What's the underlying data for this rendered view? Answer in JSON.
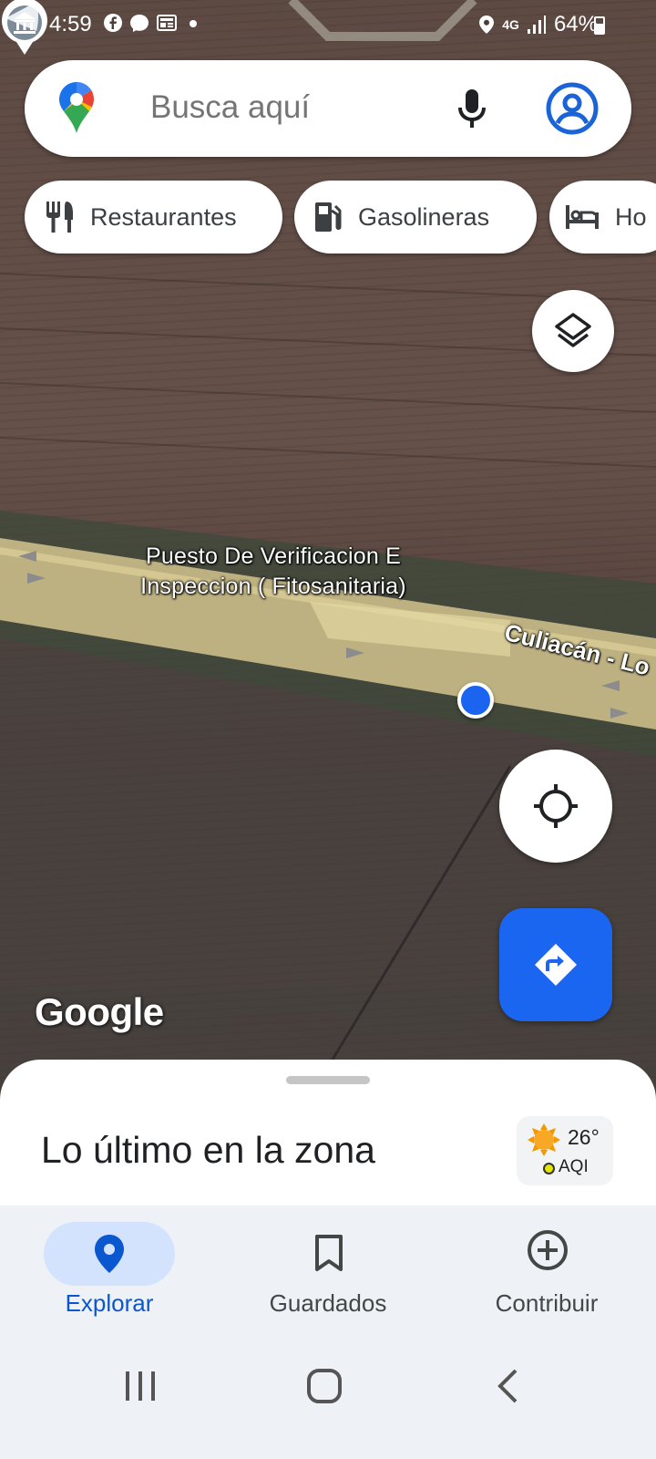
{
  "status_bar": {
    "time": "4:59",
    "left_icons": [
      "facebook-icon",
      "messenger-icon",
      "news-icon",
      "dot-icon"
    ],
    "right_icons": [
      "location-icon",
      "4g-icon",
      "signal-icon"
    ],
    "network": "4G",
    "battery": "64%"
  },
  "search": {
    "placeholder": "Busca aquí",
    "icons": [
      "maps-logo-icon",
      "mic-icon",
      "account-icon"
    ]
  },
  "chips": [
    {
      "label": "Restaurantes",
      "icon": "restaurant-icon"
    },
    {
      "label": "Gasolineras",
      "icon": "gas-station-icon"
    },
    {
      "label": "Ho",
      "icon": "hotel-icon"
    }
  ],
  "map": {
    "poi_label_line1": "Puesto De Verificacion E",
    "poi_label_line2": "Inspeccion ( Fitosanitaria)",
    "road_label": "Culiacán - Lo",
    "watermark": "Google"
  },
  "bottom_sheet": {
    "title": "Lo último en la zona",
    "weather": {
      "temperature": "26°",
      "aqi_label": "AQI"
    }
  },
  "bottom_nav": {
    "items": [
      {
        "label": "Explorar",
        "icon": "explore-pin-icon",
        "active": true
      },
      {
        "label": "Guardados",
        "icon": "bookmark-icon",
        "active": false
      },
      {
        "label": "Contribuir",
        "icon": "add-circle-icon",
        "active": false
      }
    ]
  },
  "system_nav": [
    "recent-apps-icon",
    "home-icon",
    "back-icon"
  ],
  "colors": {
    "accent_blue": "#1a66f0",
    "active_nav_bg": "#d3e3fd",
    "active_nav_text": "#0b57d0"
  }
}
